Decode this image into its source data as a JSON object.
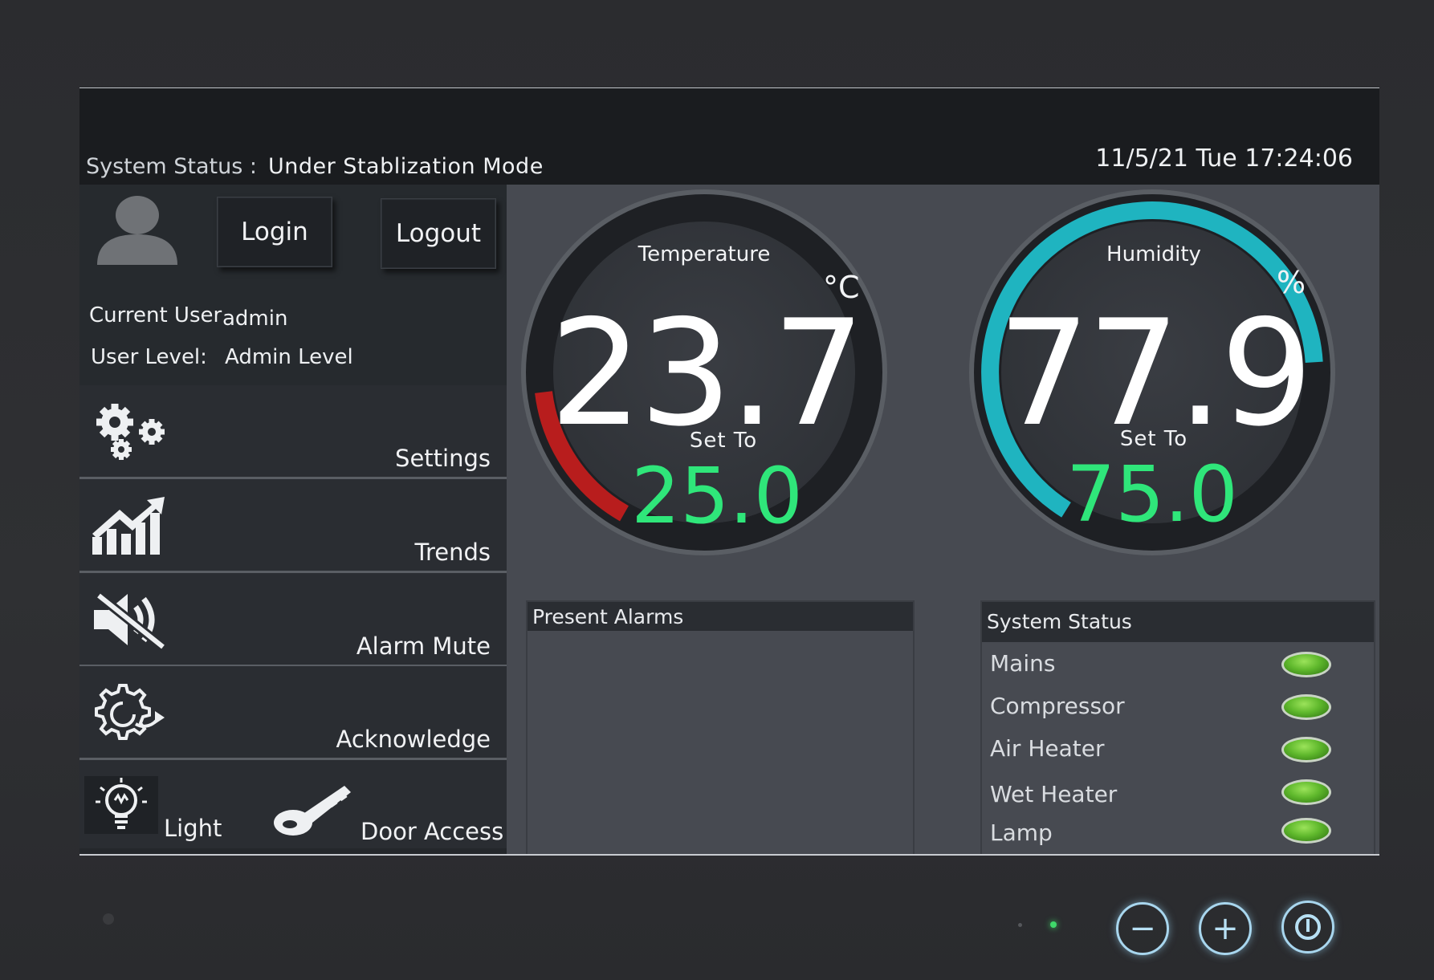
{
  "header": {
    "status_label": "System Status :",
    "status_value": "Under Stablization Mode",
    "datetime": "11/5/21 Tue 17:24:06"
  },
  "user": {
    "login_label": "Login",
    "logout_label": "Logout",
    "current_user_label": "Current User",
    "current_user_value": "admin",
    "user_level_label": "User Level:",
    "user_level_value": "Admin Level"
  },
  "menu": {
    "settings": "Settings",
    "trends": "Trends",
    "alarm_mute": "Alarm Mute",
    "acknowledge": "Acknowledge",
    "light": "Light",
    "door_access": "Door Access"
  },
  "temperature": {
    "title": "Temperature",
    "unit": "°C",
    "value": "23.7",
    "set_label": "Set To",
    "set_value": "25.0",
    "arc_color": "#b81d1d"
  },
  "humidity": {
    "title": "Humidity",
    "unit": "%",
    "value": "77.9",
    "set_label": "Set To",
    "set_value": "75.0",
    "arc_color": "#1fb4c0"
  },
  "alarms": {
    "title": "Present Alarms"
  },
  "system_status": {
    "title": "System Status",
    "items": [
      "Mains",
      "Compressor",
      "Air Heater",
      "Wet Heater",
      "Lamp"
    ],
    "led_color": "#6cc032"
  },
  "hardware": {
    "minus": "−",
    "plus": "+"
  }
}
